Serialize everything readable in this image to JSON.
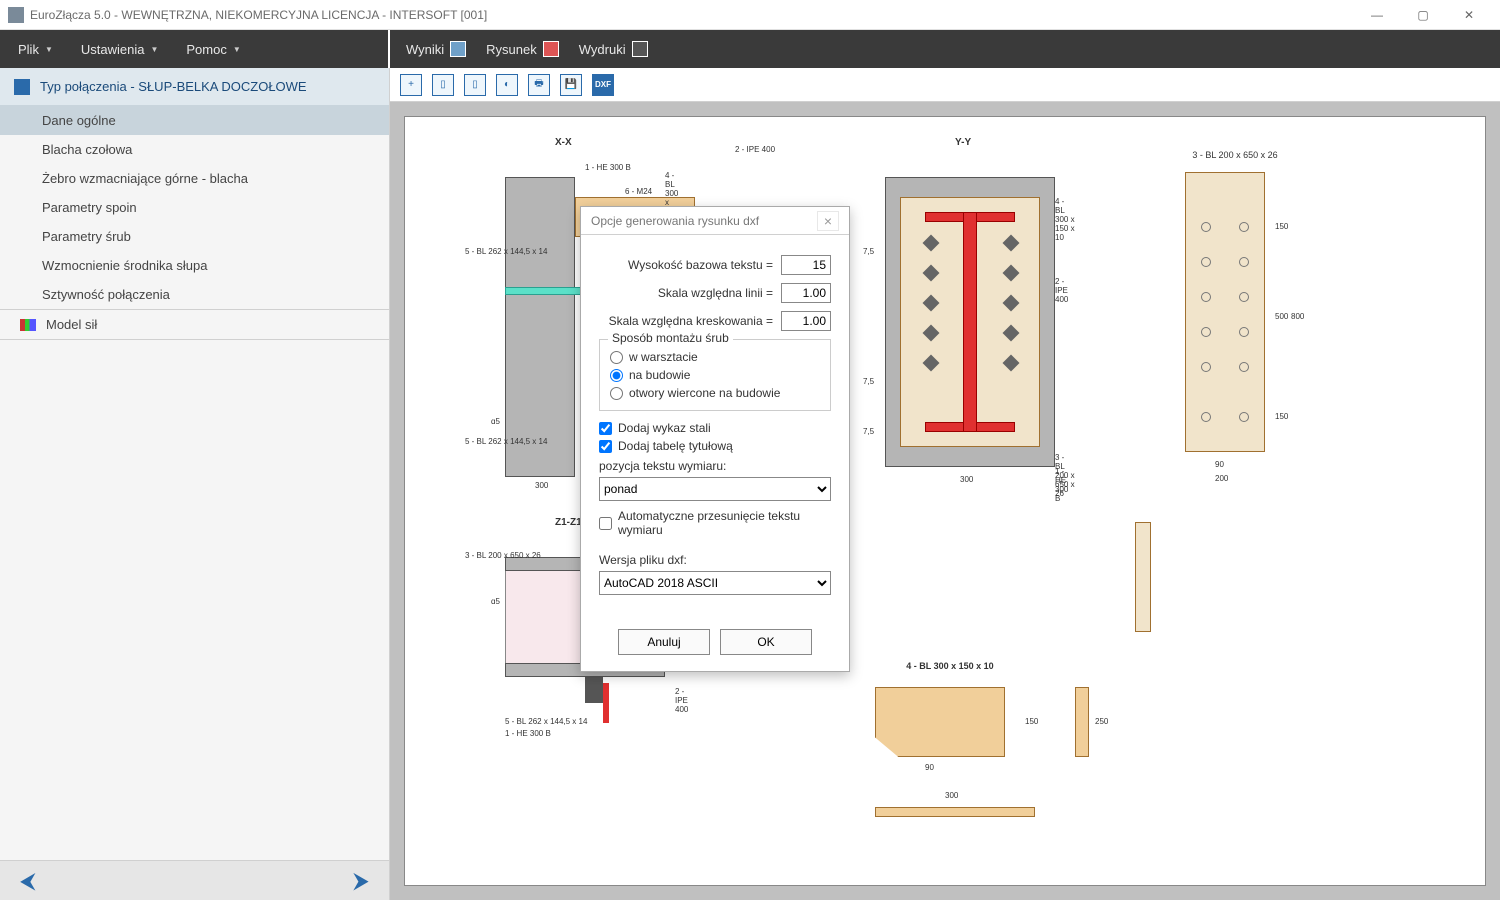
{
  "window": {
    "title": "EuroZłącza 5.0 - WEWNĘTRZNA, NIEKOMERCYJNA LICENCJA - INTERSOFT [001]"
  },
  "menu": {
    "file": "Plik",
    "settings": "Ustawienia",
    "help": "Pomoc"
  },
  "ribbon": {
    "wyniki": "Wyniki",
    "rysunek": "Rysunek",
    "wydruki": "Wydruki"
  },
  "sidebar": {
    "header": "Typ połączenia - SŁUP-BELKA DOCZOŁOWE",
    "items": [
      "Dane ogólne",
      "Blacha czołowa",
      "Żebro wzmacniające górne - blacha",
      "Parametry spoin",
      "Parametry śrub",
      "Wzmocnienie środnika słupa",
      "Sztywność połączenia"
    ],
    "selected_index": 0,
    "model": "Model sił"
  },
  "drawing": {
    "section_xx": "X-X",
    "section_yy": "Y-Y",
    "section_z1": "Z1-Z1",
    "lbl_he300b_top": "1 - HE 300 B",
    "lbl_ipe400_top": "2 - IPE 400",
    "lbl_bl300x150x10": "4 - BL 300 x 150 x 10",
    "lbl_m24": "6 - M24",
    "lbl_bl262x144_14_a": "5 - BL 262 x 144,5 x 14",
    "lbl_bl262x144_14_b": "5 - BL 262 x 144,5 x 14",
    "lbl_dim300": "300",
    "lbl_ipe400_yy": "2 - IPE 400",
    "lbl_bl300x150x10_yy": "4 - BL 300 x 150 x 10",
    "lbl_bl200x650x26_yy": "3 - BL 200 x 650 x 26",
    "lbl_he300b_yy": "1 - HE 300 B",
    "lbl_dim300_yy": "300",
    "plate_title": "3 - BL 200 x 650 x 26",
    "plate_w1": "90",
    "plate_w2": "200",
    "plate_h1": "150",
    "plate_h2": "500",
    "plate_h3": "150",
    "plate_h_tot": "800",
    "z1_lbl_bl200x650": "3 - BL 200 x 650 x 26",
    "z1_lbl_ipe400": "2 - IPE 400",
    "z1_lbl_bl262": "5 - BL 262 x 144,5 x 14",
    "z1_lbl_he300b": "1 - HE 300 B",
    "stiff_title": "4 - BL 300 x 150 x 10",
    "stiff_w": "90",
    "stiff_h": "150",
    "stiff_h2": "250",
    "bar_dim": "300",
    "yy_75a": "7,5",
    "yy_75b": "7,5",
    "yy_75c": "7,5",
    "z1_a5": "ɑ5",
    "xx_a5": "ɑ5"
  },
  "dialog": {
    "title": "Opcje generowania rysunku dxf",
    "lbl_text_height": "Wysokość bazowa tekstu =",
    "val_text_height": "15",
    "lbl_line_scale": "Skala względna linii =",
    "val_line_scale": "1.00",
    "lbl_hatch_scale": "Skala względna kreskowania =",
    "val_hatch_scale": "1.00",
    "grp_montage": "Sposób montażu śrub",
    "radio1": "w warsztacie",
    "radio2": "na budowie",
    "radio3": "otwory wiercone na budowie",
    "radio_selected": 1,
    "chk_steel_list": "Dodaj wykaz stali",
    "chk_steel_list_val": true,
    "chk_title_table": "Dodaj tabelę tytułową",
    "chk_title_table_val": true,
    "lbl_dim_text_pos": "pozycja tekstu wymiaru:",
    "sel_dim_text_pos": "ponad",
    "chk_auto_shift": "Automatyczne przesunięcie tekstu wymiaru",
    "chk_auto_shift_val": false,
    "lbl_dxf_ver": "Wersja pliku dxf:",
    "sel_dxf_ver": "AutoCAD 2018 ASCII",
    "btn_cancel": "Anuluj",
    "btn_ok": "OK"
  }
}
